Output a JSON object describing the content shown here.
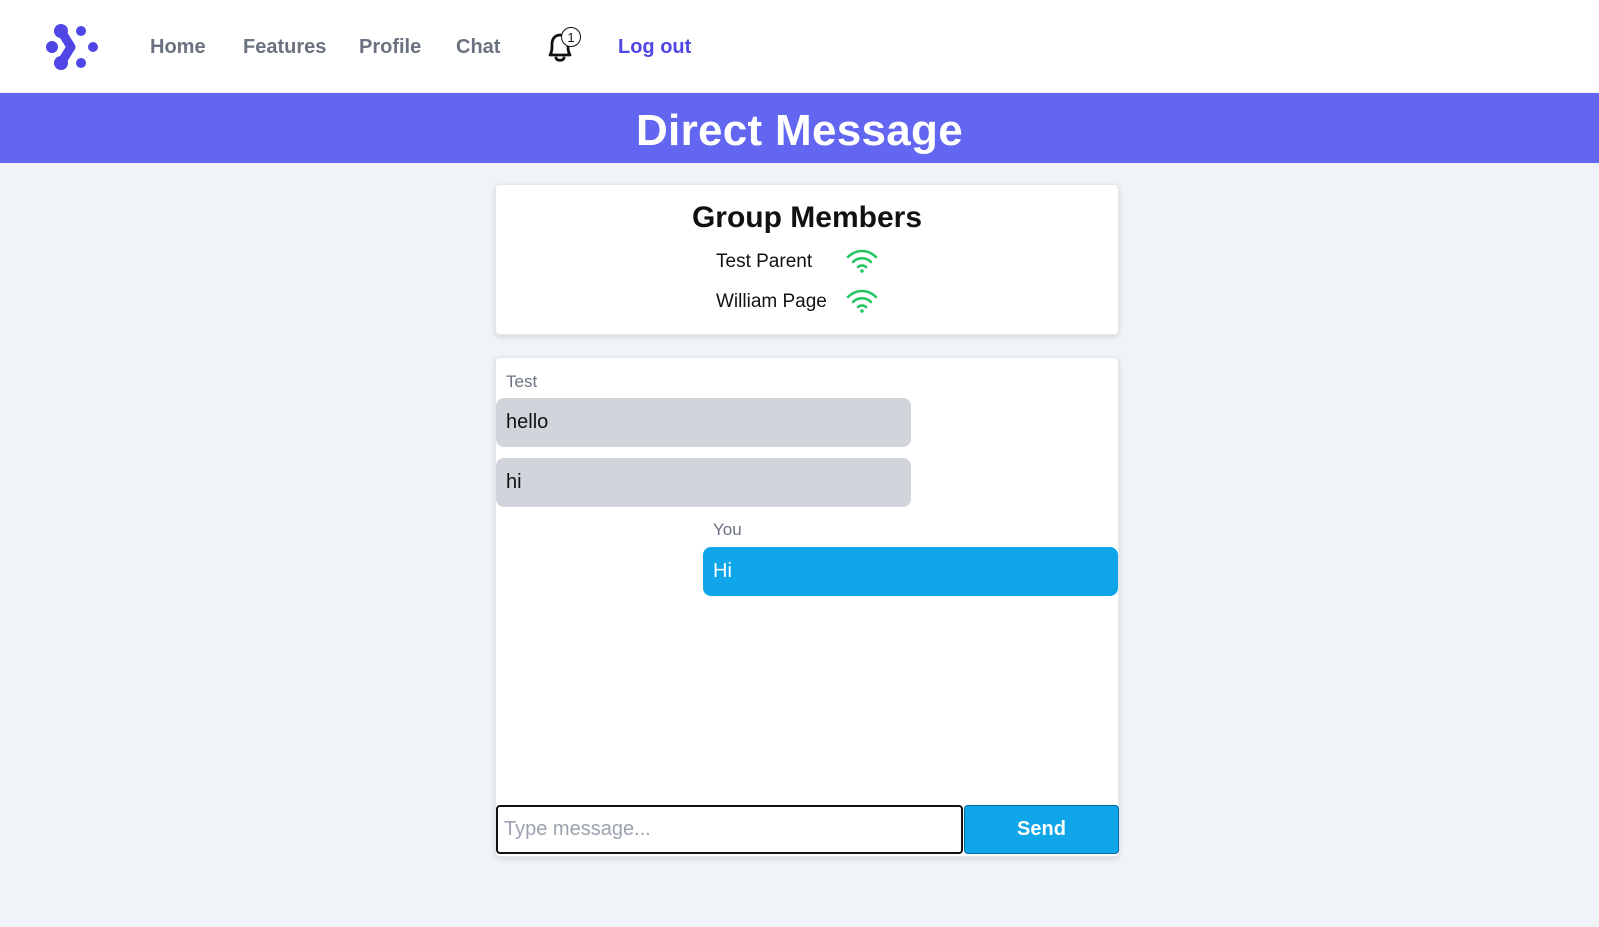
{
  "nav": {
    "links": [
      "Home",
      "Features",
      "Profile",
      "Chat"
    ],
    "notification_count": "1",
    "logout_label": "Log out"
  },
  "banner": {
    "title": "Direct Message"
  },
  "members": {
    "title": "Group Members",
    "list": [
      {
        "name": "Test Parent",
        "status_icon": "wifi-icon"
      },
      {
        "name": "William Page",
        "status_icon": "wifi-icon"
      }
    ]
  },
  "chat": {
    "incoming_sender": "Test",
    "incoming_messages": [
      "hello",
      "hi"
    ],
    "outgoing_sender": "You",
    "outgoing_messages": [
      "Hi"
    ],
    "input_placeholder": "Type message...",
    "send_label": "Send"
  },
  "colors": {
    "accent": "#6366f1",
    "logo": "#4f46e5",
    "online": "#22c55e",
    "outgoing_bubble": "#0ea5e9",
    "incoming_bubble": "#d1d5db"
  }
}
